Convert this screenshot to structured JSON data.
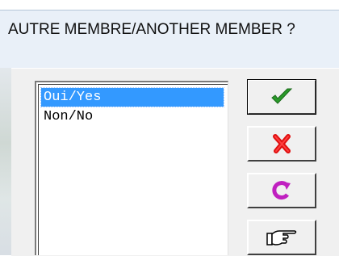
{
  "dialog": {
    "title": "AUTRE MEMBRE/ANOTHER MEMBER ?"
  },
  "options": [
    {
      "label": "Oui/Yes",
      "selected": true
    },
    {
      "label": "Non/No",
      "selected": false
    }
  ],
  "buttons": [
    {
      "name": "ok-button",
      "icon": "checkmark-icon",
      "color": "#2a9a2a"
    },
    {
      "name": "cancel-button",
      "icon": "red-x-icon",
      "color": "#e01010"
    },
    {
      "name": "refresh-button",
      "icon": "circular-arrow-icon",
      "color": "#c020c0"
    },
    {
      "name": "pointer-button",
      "icon": "pointing-hand-icon",
      "color": "#000000"
    }
  ],
  "colors": {
    "selection": "#3399ff",
    "dialog_bg": "#f0f0f0"
  }
}
